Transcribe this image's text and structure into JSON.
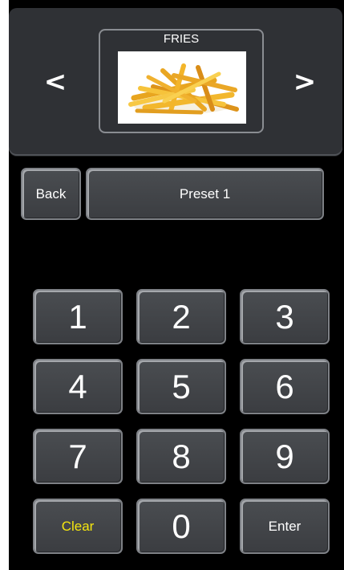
{
  "carousel": {
    "prev_label": "<",
    "next_label": ">",
    "product_name": "FRIES",
    "product_image_icon": "fries-image"
  },
  "controls": {
    "back_label": "Back",
    "preset_label": "Preset 1"
  },
  "keypad": {
    "keys": [
      "1",
      "2",
      "3",
      "4",
      "5",
      "6",
      "7",
      "8",
      "9",
      "Clear",
      "0",
      "Enter"
    ]
  },
  "colors": {
    "background": "#000000",
    "panel": "#2f3135",
    "button": "#43464a",
    "clear_text": "#f5e60f"
  }
}
